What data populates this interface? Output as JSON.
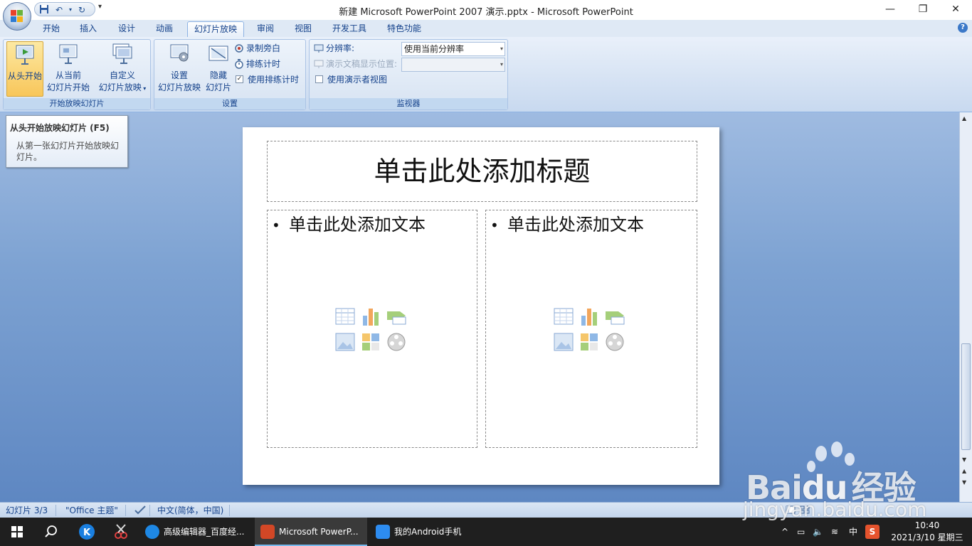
{
  "window": {
    "title": "新建 Microsoft PowerPoint 2007 演示.pptx - Microsoft PowerPoint"
  },
  "tabs": [
    "开始",
    "插入",
    "设计",
    "动画",
    "幻灯片放映",
    "审阅",
    "视图",
    "开发工具",
    "特色功能"
  ],
  "active_tab": "幻灯片放映",
  "ribbon": {
    "group_start": {
      "label": "开始放映幻灯片",
      "from_beginning": "从头开始",
      "from_current_1": "从当前",
      "from_current_2": "幻灯片开始",
      "custom_1": "自定义",
      "custom_2": "幻灯片放映"
    },
    "group_setup": {
      "label": "设置",
      "setup_1": "设置",
      "setup_2": "幻灯片放映",
      "hide_1": "隐藏",
      "hide_2": "幻灯片",
      "record": "录制旁白",
      "rehearse": "排练计时",
      "use_timings": "使用排练计时",
      "use_timings_checked": true
    },
    "group_monitor": {
      "label": "监视器",
      "resolution_label": "分辨率:",
      "resolution_value": "使用当前分辨率",
      "show_on_label": "演示文稿显示位置:",
      "show_on_value": "",
      "presenter_view": "使用演示者视图",
      "presenter_view_checked": false
    }
  },
  "tooltip": {
    "title": "从头开始放映幻灯片 (F5)",
    "body": "从第一张幻灯片开始放映幻灯片。"
  },
  "slide": {
    "title_placeholder": "单击此处添加标题",
    "left_text": "单击此处添加文本",
    "right_text": "单击此处添加文本"
  },
  "statusbar": {
    "slide_info": "幻灯片 3/3",
    "theme": "\"Office 主题\"",
    "language": "中文(简体，中国)"
  },
  "taskbar": {
    "apps": [
      {
        "label": "高级编辑器_百度经...",
        "active": false
      },
      {
        "label": "Microsoft PowerP...",
        "active": true
      },
      {
        "label": "我的Android手机",
        "active": false
      }
    ],
    "ime": "中",
    "time": "10:40",
    "date": "2021/3/10 星期三"
  },
  "watermark": {
    "brand_left": "Bai",
    "brand_mid": "du",
    "brand_right": "经验",
    "url": "jingyan.baidu.com"
  },
  "colors": {
    "accent": "#15428b",
    "active_button": "#f8c65a",
    "workspace": "#7da2d2"
  }
}
